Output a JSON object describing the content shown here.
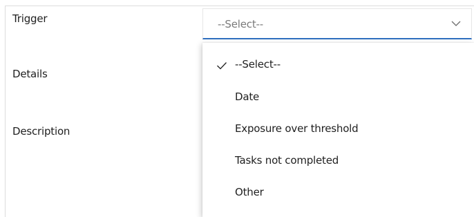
{
  "form": {
    "labels": {
      "trigger": "Trigger",
      "details": "Details",
      "description": "Description"
    },
    "trigger_select": {
      "selected_value": "--Select--",
      "expanded": true
    }
  },
  "dropdown": {
    "options": [
      {
        "label": "--Select--",
        "selected": true
      },
      {
        "label": "Date",
        "selected": false
      },
      {
        "label": "Exposure over threshold",
        "selected": false
      },
      {
        "label": "Tasks not completed",
        "selected": false
      },
      {
        "label": "Other",
        "selected": false
      }
    ]
  },
  "icons": {
    "chevron": "chevron-down-icon",
    "check": "checkmark-icon"
  },
  "colors": {
    "accent_underline": "#2f6fbf",
    "text": "#1f1f1f",
    "placeholder": "#7a7a7a",
    "border": "#e6e6e6"
  }
}
